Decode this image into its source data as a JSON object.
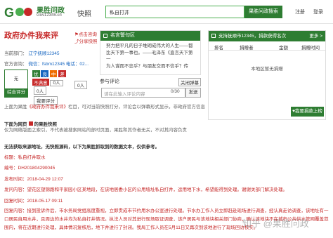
{
  "header": {
    "logo_title": "果胜问政",
    "logo_sub": "Gov12345.cn",
    "nav_kuaizhao": "快照",
    "search_value": "私自打井",
    "search_button": "果胜问政搜索",
    "register": "注册",
    "login": "登录"
  },
  "left": {
    "page_title": "政府办件我来评",
    "links": [
      "点击咨询",
      "分享快照"
    ],
    "dept_label": "当前部门：",
    "dept_value": "辽宁抚顺12345",
    "official_label": "官方咨询：",
    "official_value": "微信：fsbm12345 电话：02...",
    "no_label": "无",
    "rating_label": "综合评分",
    "ratings": [
      "优",
      "良",
      "中",
      "差"
    ],
    "unsatisfied": "不满意",
    "count1": "0人",
    "count2": "0人",
    "count3": "0人",
    "rate_action": "我要评分",
    "upload_text_a": "上面为果胜",
    "upload_link": "《政府办件我来评》",
    "upload_text_b": "栏目，可对当前快照打分，评论会以弹幕形式显示，非政府官方信息",
    "below_heading_a": "下面为网页",
    "below_heading_b": "的果胜快照",
    "below_note": "仅为网络版面之索引，不代表被搜索网站的部时页面，果胜和其作者无关，不对其内容负责",
    "notice": "无法获取来源地址，无快照源码，以下为果胜抓取到的数据文本，仅供参考。",
    "title_label": "标题：",
    "title_value": "私自打井取水",
    "code_label": "编号：",
    "code_value": "DH201804290045",
    "time_label": "发布时间：",
    "time_value": "2018-04-29 12:07",
    "content_label": "发问内容：",
    "content_value": "望花区塑锦路和平家园小区某地段，在该地居委小区的公用墙址私自打井，运用地下水，希望能得到处理。谢谢关部门解决处理。",
    "reply_time_label": "回复时间：",
    "reply_time_value": "2018-05-17 09:11",
    "reply_label": "回复内容：",
    "reply_value": "接到投诉件后，市水务局党组高度重视，立即责成市节约用水办公室进行处理。节水办工作人员立即赶赴现场进行调查，经认真走访调查，该地址有一口居民自用水井，且周边的水井均为私自打井情况。执法人员对其进行现场取证调查，该户居民与该地块相关部门协商，确认该地块不在城市公共供水管网覆盖范围内，将在近期进行处理，具体情况复核后，地下井进行了封闭。我局工作人员在5月11日又再次到该地进行了现场回访核实。"
  },
  "news": {
    "head": "名言警句区",
    "lines": [
      "努力把平凡的日子堆砌成伟大的人生——都",
      "比天下第一事也。——毛泽东《直言天下第一",
      "为人谋而不忠乎？与朋友交而不信乎？传"
    ]
  },
  "comment": {
    "label": "参与评论",
    "close": "关闭弹幕",
    "placeholder": "请在此输入评论内容",
    "count": "0/30",
    "send": "发送"
  },
  "rank": {
    "head": "支持抚顺市12345，捐款获得名次",
    "more": "更多 >",
    "columns": [
      "排名",
      "捐赠者",
      "金额",
      "捐赠时间"
    ],
    "empty": "本地区暂无捐赠",
    "button": "我要捐款上榜"
  },
  "watermark": "知乎 @果胜问政",
  "colors": {
    "brand_green": "#2e7d32",
    "accent_red": "#c62828"
  }
}
